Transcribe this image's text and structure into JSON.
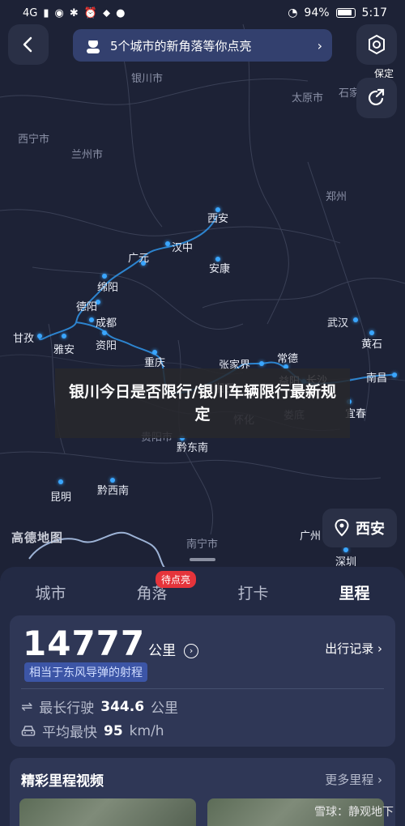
{
  "status_bar": {
    "network": "4G",
    "battery": "94%",
    "time": "5:17"
  },
  "banner": {
    "text": "5个城市的新角落等你点亮"
  },
  "side": {
    "settings_label": "保定"
  },
  "map": {
    "logo": "高德地图",
    "cities": [
      {
        "name": "银川市",
        "dim": true
      },
      {
        "name": "太原市",
        "dim": true
      },
      {
        "name": "石家",
        "dim": true
      },
      {
        "name": "西宁市",
        "dim": true
      },
      {
        "name": "兰州市",
        "dim": true
      },
      {
        "name": "郑州",
        "dim": true
      },
      {
        "name": "西安",
        "dim": false
      },
      {
        "name": "汉中",
        "dim": false
      },
      {
        "name": "广元",
        "dim": false
      },
      {
        "name": "安康",
        "dim": false
      },
      {
        "name": "绵阳",
        "dim": false
      },
      {
        "name": "德阳",
        "dim": false
      },
      {
        "name": "成都",
        "dim": false
      },
      {
        "name": "甘孜",
        "dim": false
      },
      {
        "name": "雅安",
        "dim": false
      },
      {
        "name": "资阳",
        "dim": false
      },
      {
        "name": "重庆",
        "dim": false
      },
      {
        "name": "武汉",
        "dim": false
      },
      {
        "name": "黄石",
        "dim": false
      },
      {
        "name": "张家界",
        "dim": false
      },
      {
        "name": "常德",
        "dim": false
      },
      {
        "name": "益阳",
        "dim": false
      },
      {
        "name": "长沙",
        "dim": false
      },
      {
        "name": "南昌",
        "dim": false
      },
      {
        "name": "湘西",
        "dim": false
      },
      {
        "name": "怀化",
        "dim": true
      },
      {
        "name": "娄底",
        "dim": true
      },
      {
        "name": "宜春",
        "dim": false
      },
      {
        "name": "贵阳市",
        "dim": true
      },
      {
        "name": "黔东南",
        "dim": false
      },
      {
        "name": "昆明",
        "dim": false
      },
      {
        "name": "黔西南",
        "dim": false
      },
      {
        "name": "南宁市",
        "dim": true
      },
      {
        "name": "广州",
        "dim": false
      },
      {
        "name": "深圳",
        "dim": false
      }
    ]
  },
  "overlay": {
    "text": "银川今日是否限行/银川车辆限行最新规定"
  },
  "location": {
    "label": "西安"
  },
  "tabs": [
    {
      "label": "城市"
    },
    {
      "label": "角落"
    },
    {
      "label": "打卡"
    },
    {
      "label": "里程"
    }
  ],
  "tab_badge": "待点亮",
  "stats": {
    "distance": "14777",
    "unit": "公里",
    "records_label": "出行记录 ›",
    "tag": "相当于东风导弹的射程",
    "longest_label": "最长行驶",
    "longest_value": "344.6",
    "longest_unit": "公里",
    "fastest_label": "平均最快",
    "fastest_value": "95",
    "fastest_unit": "km/h"
  },
  "videos": {
    "title": "精彩里程视频",
    "more": "更多里程 ›"
  },
  "watermark": "雪球：静观地下"
}
